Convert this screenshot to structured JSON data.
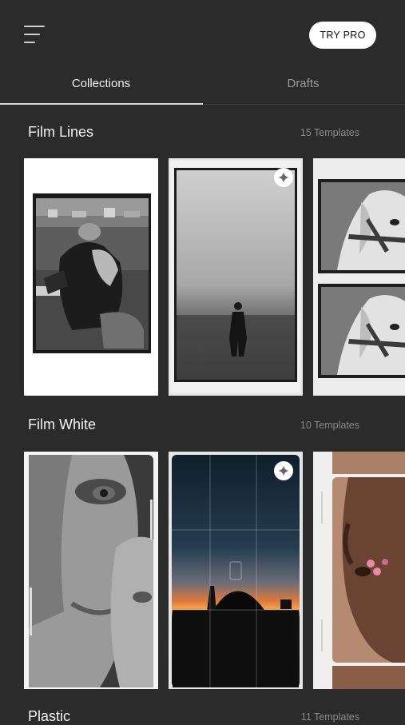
{
  "header": {
    "try_pro_label": "TRY PRO"
  },
  "tabs": [
    {
      "label": "Collections",
      "active": true
    },
    {
      "label": "Drafts",
      "active": false
    }
  ],
  "collections": [
    {
      "title": "Film Lines",
      "count": "15 Templates"
    },
    {
      "title": "Film White",
      "count": "10 Templates"
    },
    {
      "title": "Plastic",
      "count": "11 Templates"
    }
  ],
  "icons": {
    "menu": "hamburger-menu-icon",
    "premium": "sparkle-icon"
  },
  "colors": {
    "background": "#2b2b2b",
    "button": "#ffffff",
    "text": "#f2f2f2",
    "muted": "#8a8a8a"
  }
}
